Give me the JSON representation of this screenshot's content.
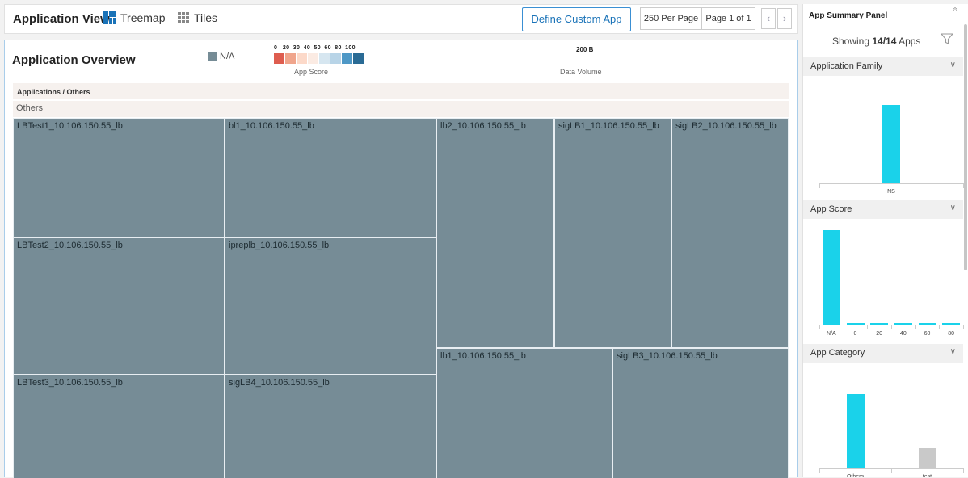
{
  "header": {
    "title": "Application View",
    "treemap_label": "Treemap",
    "tiles_label": "Tiles",
    "define_button": "Define Custom App",
    "per_page": "250 Per Page",
    "page_indicator": "Page 1 of 1",
    "prev_arrow": "‹",
    "next_arrow": "›"
  },
  "overview": {
    "title": "Application Overview",
    "na_legend": "N/A",
    "score_ticks": "0   20  30  40  50  60  80  100",
    "score_colors": [
      "#de5d4f",
      "#f0a58c",
      "#fcd9c9",
      "#fbebe3",
      "#d6e6f0",
      "#b8d4e7",
      "#4e98c6",
      "#2a6b95"
    ],
    "score_label": "App Score",
    "volume_value": "200 B",
    "volume_label": "Data Volume",
    "breadcrumb": "Applications / Others",
    "group_label": "Others"
  },
  "treemap": {
    "tiles": [
      {
        "label": "LBTest1_10.106.150.55_lb"
      },
      {
        "label": "bl1_10.106.150.55_lb"
      },
      {
        "label": "lb2_10.106.150.55_lb"
      },
      {
        "label": "sigLB1_10.106.150.55_lb"
      },
      {
        "label": "sigLB2_10.106.150.55_lb"
      },
      {
        "label": "LBTest2_10.106.150.55_lb"
      },
      {
        "label": "ipreplb_10.106.150.55_lb"
      },
      {
        "label": "lb1_10.106.150.55_lb"
      },
      {
        "label": "sigLB3_10.106.150.55_lb"
      },
      {
        "label": "LBTest3_10.106.150.55_lb"
      },
      {
        "label": "sigLB4_10.106.150.55_lb"
      }
    ]
  },
  "summary": {
    "title": "App Summary Panel",
    "collapse_icon": "»",
    "showing_prefix": "Showing",
    "showing_count": "14/14",
    "showing_suffix": "Apps",
    "sections": {
      "family": {
        "title": "Application Family",
        "chevron": "∨"
      },
      "score": {
        "title": "App Score",
        "chevron": "∨"
      },
      "category": {
        "title": "App Category",
        "chevron": "∨"
      }
    }
  },
  "chart_data": [
    {
      "type": "bar",
      "title": "Application Family",
      "categories": [
        "NS"
      ],
      "values": [
        14
      ]
    },
    {
      "type": "bar",
      "title": "App Score",
      "categories": [
        "N/A",
        "0",
        "20",
        "40",
        "60",
        "80"
      ],
      "values": [
        14,
        0,
        0,
        0,
        0,
        0
      ]
    },
    {
      "type": "bar",
      "title": "App Category",
      "categories": [
        "Others",
        "test"
      ],
      "values": [
        11,
        3
      ],
      "colors": [
        "#1ad2ea",
        "#c9c9c9"
      ]
    }
  ]
}
